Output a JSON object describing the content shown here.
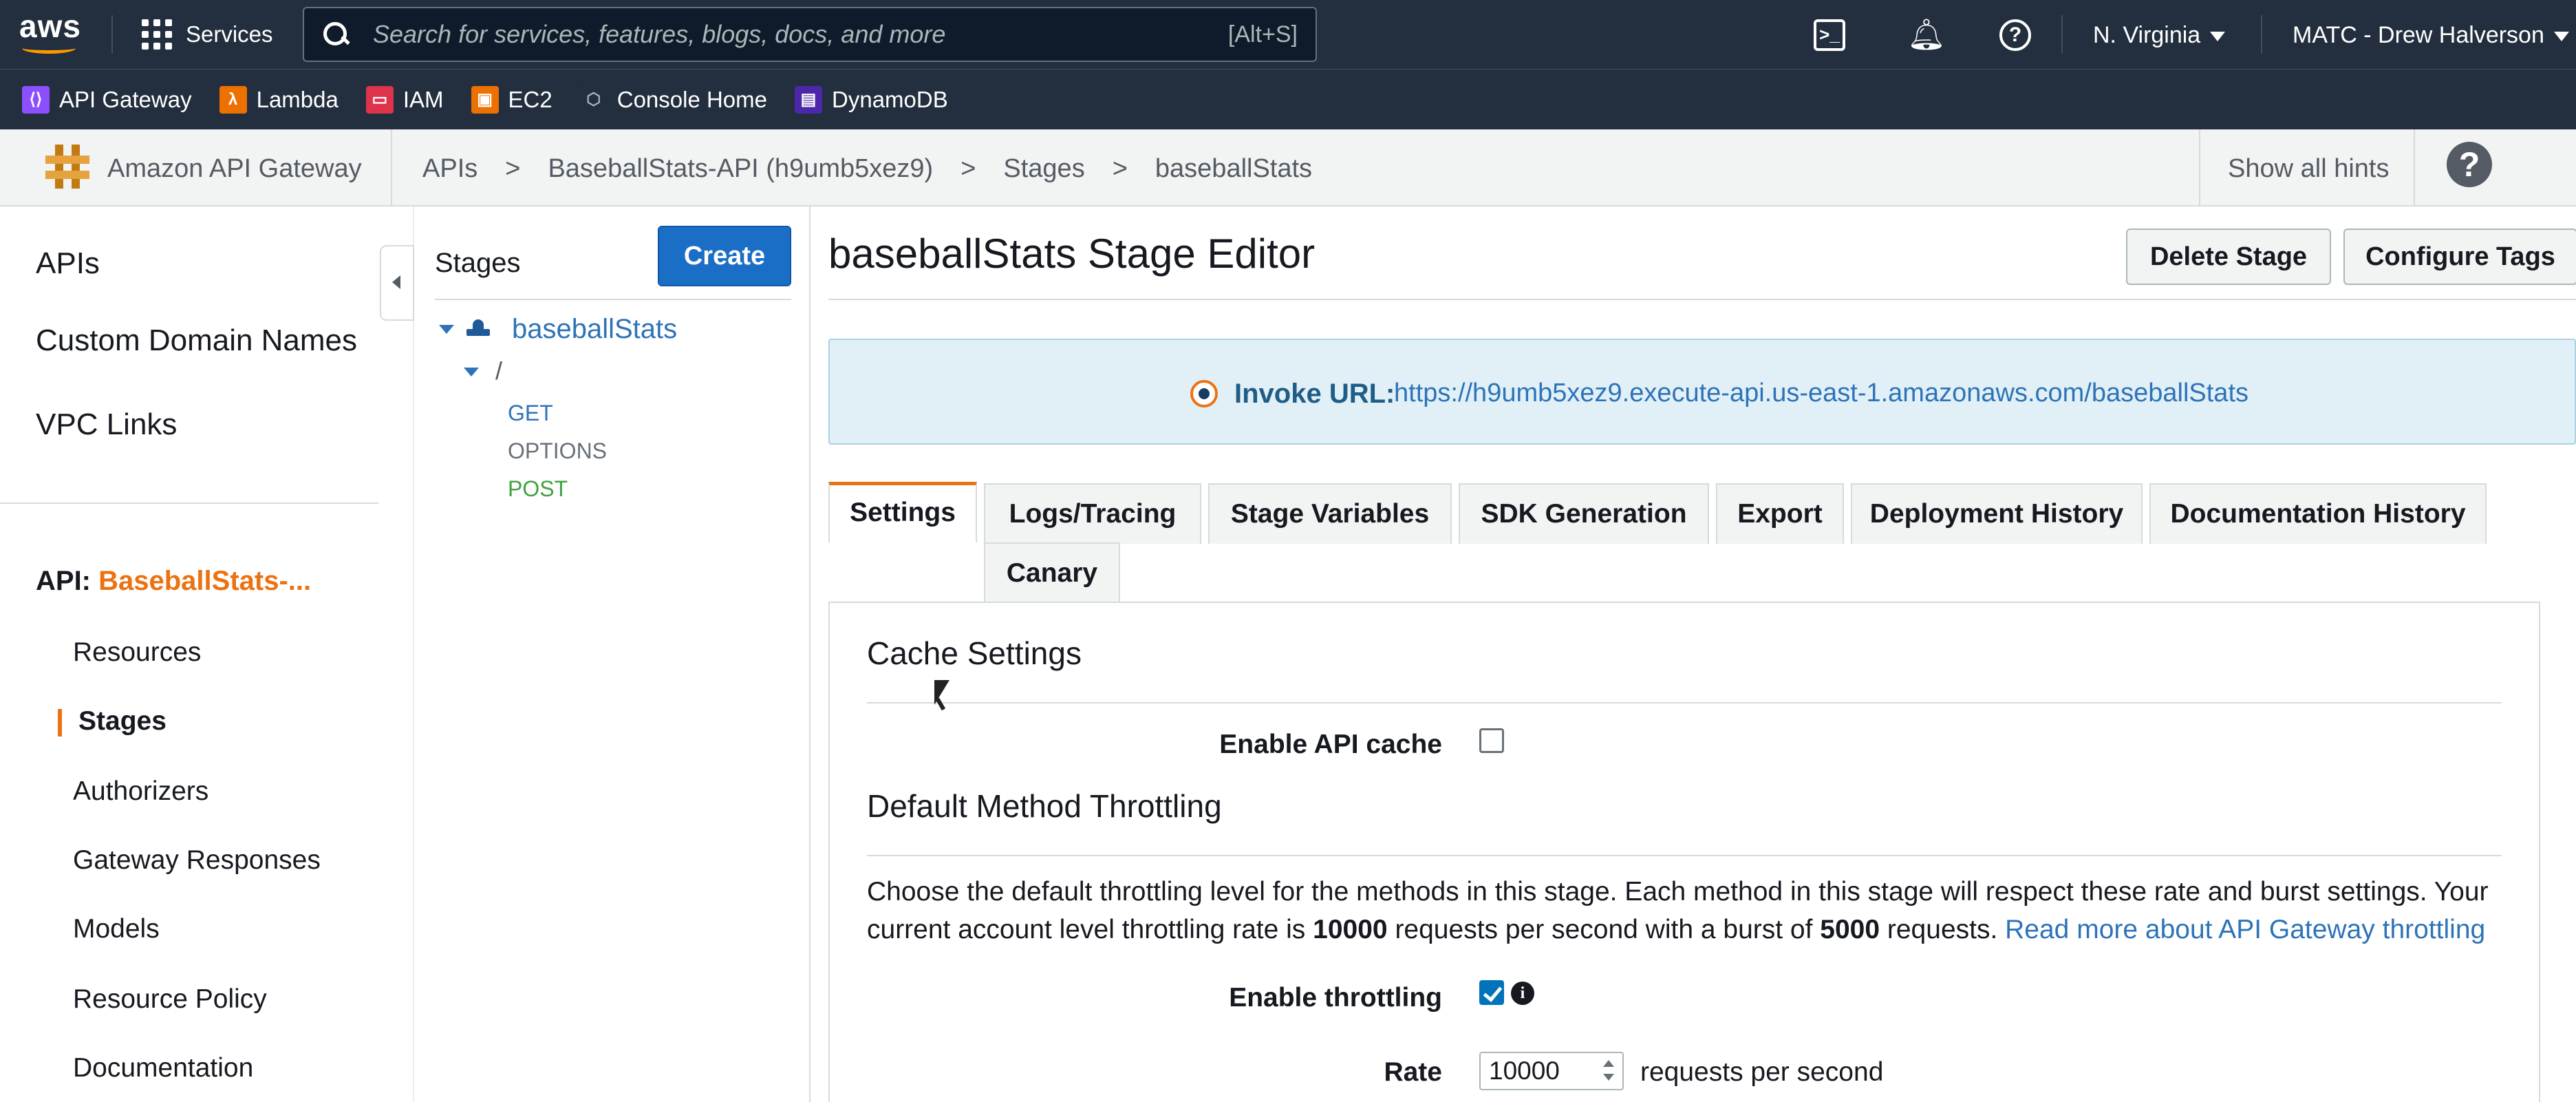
{
  "topnav": {
    "services_label": "Services",
    "search_placeholder": "Search for services, features, blogs, docs, and more",
    "search_shortcut": "[Alt+S]",
    "region": "N. Virginia",
    "account": "MATC - Drew Halverson"
  },
  "favorites": [
    {
      "label": "API Gateway",
      "icon": "api-gateway-icon",
      "color": "#8c4fff"
    },
    {
      "label": "Lambda",
      "icon": "lambda-icon",
      "color": "#ed7100"
    },
    {
      "label": "IAM",
      "icon": "iam-icon",
      "color": "#dd344c"
    },
    {
      "label": "EC2",
      "icon": "ec2-icon",
      "color": "#ed7100"
    },
    {
      "label": "Console Home",
      "icon": "console-home-icon",
      "color": "#687078"
    },
    {
      "label": "DynamoDB",
      "icon": "dynamodb-icon",
      "color": "#4d27aa"
    }
  ],
  "service": {
    "name": "Amazon API Gateway",
    "breadcrumb": [
      "APIs",
      ">",
      "BaseballStats-API (h9umb5xez9)",
      ">",
      "Stages",
      ">",
      "baseballStats"
    ],
    "show_hints": "Show all hints"
  },
  "leftnav": {
    "top_items": [
      "APIs",
      "Custom Domain Names",
      "VPC Links"
    ],
    "api_prefix": "API:",
    "api_name": "BaseballStats-...",
    "sub_items": [
      "Resources",
      "Stages",
      "Authorizers",
      "Gateway Responses",
      "Models",
      "Resource Policy",
      "Documentation"
    ],
    "active": "Stages"
  },
  "tree": {
    "title": "Stages",
    "create_label": "Create",
    "stage": "baseballStats",
    "root": "/",
    "methods": [
      {
        "label": "GET",
        "color": "#2e73b8"
      },
      {
        "label": "OPTIONS",
        "color": "#687078"
      },
      {
        "label": "POST",
        "color": "#3fa23f"
      }
    ]
  },
  "editor": {
    "title": "baseballStats Stage Editor",
    "delete_label": "Delete Stage",
    "tags_label": "Configure Tags",
    "invoke_label": "Invoke URL:",
    "invoke_url": "https://h9umb5xez9.execute-api.us-east-1.amazonaws.com/baseballStats",
    "tabs": [
      "Settings",
      "Logs/Tracing",
      "Stage Variables",
      "SDK Generation",
      "Export",
      "Deployment History",
      "Documentation History",
      "Canary"
    ],
    "active_tab": "Settings",
    "cache_title": "Cache Settings",
    "enable_cache_label": "Enable API cache",
    "cache_enabled": false,
    "throttling_title": "Default Method Throttling",
    "throttling_desc_1": "Choose the default throttling level for the methods in this stage. Each method in this stage will respect these rate and burst settings. Your current account level throttling rate is ",
    "throttling_rate_value": "10000",
    "throttling_desc_2": " requests per second with a burst of ",
    "throttling_burst_value": "5000",
    "throttling_desc_3": " requests. ",
    "throttling_link": "Read more about API Gateway throttling",
    "enable_throttling_label": "Enable throttling",
    "throttling_enabled": true,
    "rate_label": "Rate",
    "rate_value": "10000",
    "rate_unit": "requests per second"
  }
}
